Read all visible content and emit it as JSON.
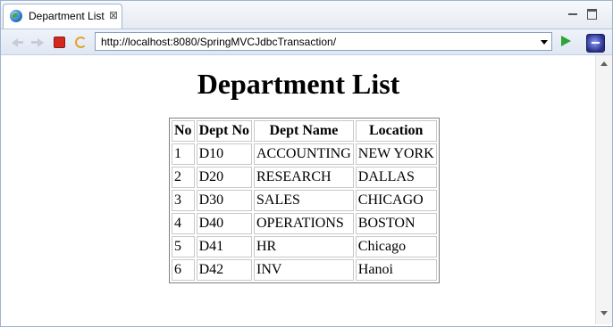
{
  "tab": {
    "title": "Department List",
    "close_glyph": "⊠"
  },
  "toolbar": {
    "url": "http://localhost:8080/SpringMVCJdbcTransaction/"
  },
  "page": {
    "title": "Department List",
    "table": {
      "headers": [
        "No",
        "Dept No",
        "Dept Name",
        "Location"
      ],
      "rows": [
        [
          "1",
          "D10",
          "ACCOUNTING",
          "NEW YORK"
        ],
        [
          "2",
          "D20",
          "RESEARCH",
          "DALLAS"
        ],
        [
          "3",
          "D30",
          "SALES",
          "CHICAGO"
        ],
        [
          "4",
          "D40",
          "OPERATIONS",
          "BOSTON"
        ],
        [
          "5",
          "D41",
          "HR",
          "Chicago"
        ],
        [
          "6",
          "D42",
          "INV",
          "Hanoi"
        ]
      ]
    }
  },
  "icons": {
    "tab": "globe-icon",
    "back": "back-arrow-icon",
    "forward": "forward-arrow-icon",
    "stop": "stop-icon",
    "refresh": "refresh-icon",
    "go": "go-icon",
    "app": "eclipse-icon"
  },
  "colors": {
    "stop": "#d4281e",
    "go": "#2da33a",
    "frame_border": "#9fb3cf"
  }
}
